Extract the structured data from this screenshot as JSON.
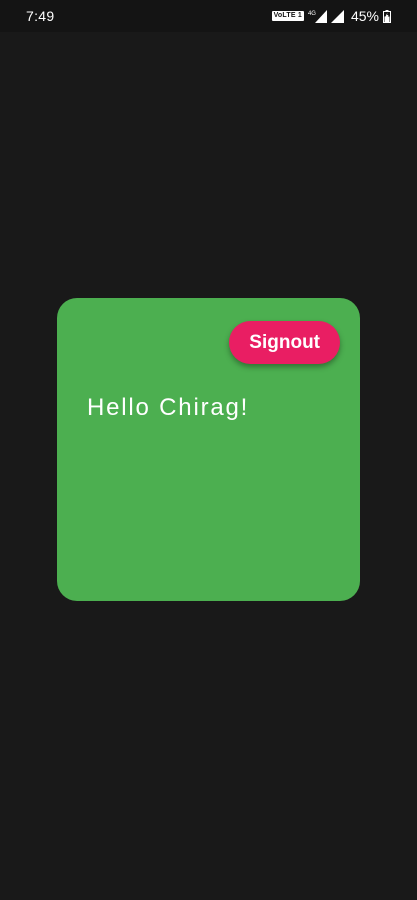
{
  "status_bar": {
    "time": "7:49",
    "volte_label": "VoLTE 1",
    "network_label": "4G",
    "battery_percent": "45%"
  },
  "card": {
    "color": "#4caf50",
    "signout_label": "Signout",
    "signout_color": "#e91e63",
    "greeting": "Hello Chirag!"
  },
  "icons": [
    "volte-icon",
    "data-arrows-icon",
    "signal-icon",
    "battery-icon"
  ]
}
